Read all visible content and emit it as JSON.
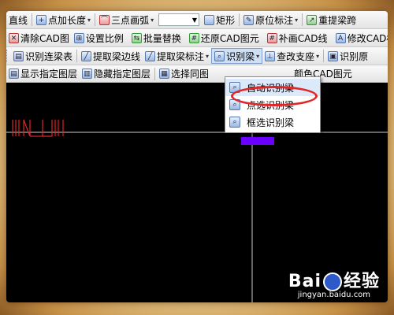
{
  "toolbar1": {
    "items": [
      "直线",
      "点加长度",
      "三点画弧",
      "矩形",
      "原位标注",
      "重提梁跨"
    ]
  },
  "toolbar2": {
    "items": [
      "清除CAD图",
      "设置比例",
      "批量替换",
      "还原CAD图元",
      "补画CAD线",
      "修改CAD标"
    ]
  },
  "toolbar3": {
    "items": [
      "识别连梁表",
      "提取梁边线",
      "提取梁标注",
      "识别梁",
      "查改支座",
      "识别原"
    ]
  },
  "toolbar4": {
    "items": [
      "显示指定图层",
      "隐藏指定图层",
      "选择同图",
      "颜色CAD图元"
    ]
  },
  "dropdown": {
    "items": [
      "自动识别梁",
      "点选识别梁",
      "框选识别梁"
    ],
    "highlighted_index": 0
  },
  "watermark": {
    "logo_a": "Bai",
    "logo_b": "经验",
    "url": "jingyan.baidu.com"
  },
  "colors": {
    "canvas_bg": "#000000",
    "cad_red": "#e02626",
    "cad_white": "#cccccc",
    "highlight_purple": "#6a00ff"
  },
  "icons": {
    "point-length": "plus-circle-icon",
    "arc": "arc-icon",
    "rect": "rectangle-icon",
    "annotate": "annotate-icon",
    "respan": "respan-icon"
  }
}
